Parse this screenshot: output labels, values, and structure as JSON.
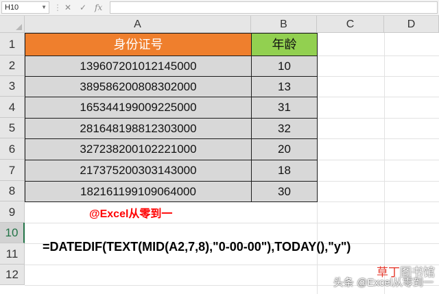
{
  "formula_bar": {
    "name_box": "H10",
    "cancel": "✕",
    "enter": "✓",
    "fx": "fx"
  },
  "columns": [
    "A",
    "B",
    "C",
    "D"
  ],
  "rows": [
    "1",
    "2",
    "3",
    "4",
    "5",
    "6",
    "7",
    "8",
    "9",
    "10",
    "11",
    "12"
  ],
  "selected_row": "10",
  "table": {
    "headers": [
      "身份证号",
      "年龄"
    ],
    "rows": [
      [
        "139607201012145000",
        "10"
      ],
      [
        "389586200808302000",
        "13"
      ],
      [
        "165344199009225000",
        "31"
      ],
      [
        "281648198812303000",
        "32"
      ],
      [
        "327238200102221000",
        "20"
      ],
      [
        "217375200303143000",
        "18"
      ],
      [
        "182161199109064000",
        "30"
      ]
    ]
  },
  "header_colors": {
    "id_header": "#ef7f2d",
    "age_header": "#92d050",
    "data_fill": "#d8d8d8"
  },
  "credit": "@Excel从零到一",
  "formula_text": "=DATEDIF(TEXT(MID(A2,7,8),\"0-00-00\"),TODAY(),\"y\")",
  "watermark": {
    "site_part1": "草丁",
    "site_part2": "图书馆",
    "source": "头条 @Excel从零到一"
  }
}
